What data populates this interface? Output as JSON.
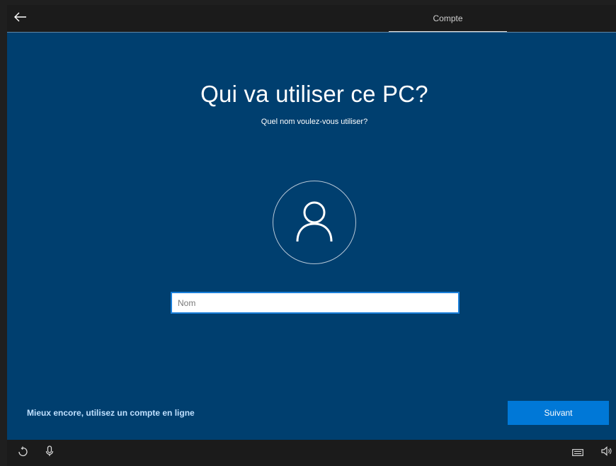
{
  "header": {
    "active_tab": "Compte"
  },
  "main": {
    "title": "Qui va utiliser ce PC?",
    "subtitle": "Quel nom voulez-vous utiliser?",
    "name_input": {
      "value": "",
      "placeholder": "Nom"
    },
    "online_account_link": "Mieux encore, utilisez un compte en ligne",
    "next_button": "Suivant"
  },
  "icons": {
    "back": "back-arrow-icon",
    "avatar": "user-icon",
    "accessibility": "ease-of-access-icon",
    "microphone": "microphone-icon",
    "keyboard": "keyboard-icon",
    "volume": "volume-icon"
  },
  "colors": {
    "background": "#003f6f",
    "accent": "#0078d7",
    "input_border": "#1a7fd9",
    "link": "#bfe0ff",
    "bar": "#1b1b1b"
  }
}
